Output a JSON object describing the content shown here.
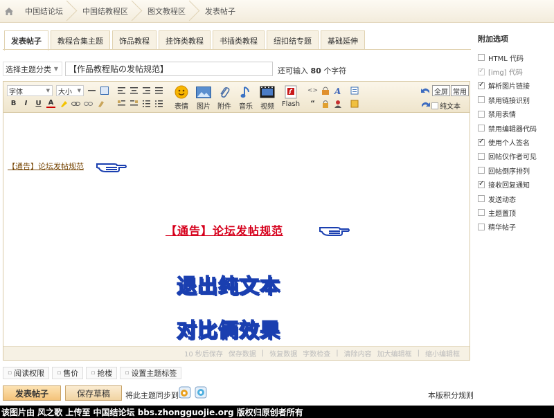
{
  "breadcrumb": {
    "items": [
      "中国结论坛",
      "中国结教程区",
      "图文教程区",
      "发表帖子"
    ]
  },
  "tabs": [
    {
      "label": "发表帖子",
      "active": true
    },
    {
      "label": "教程合集主题"
    },
    {
      "label": "饰品教程"
    },
    {
      "label": "挂饰类教程"
    },
    {
      "label": "书插类教程"
    },
    {
      "label": "纽扣结专题"
    },
    {
      "label": "基础延伸"
    }
  ],
  "form": {
    "type_select": "选择主题分类",
    "subject_value": "【作品教程贴の发帖规范】",
    "remain_prefix": "还可输入",
    "remain_count": "80",
    "remain_suffix": "个字符"
  },
  "toolbar": {
    "font": "字体",
    "size": "大小",
    "emoji": "表情",
    "image": "图片",
    "attach": "附件",
    "music": "音乐",
    "video": "视频",
    "flash": "Flash",
    "fullscreen": "全屏",
    "common": "常用",
    "plain": "纯文本",
    "btn_b": "B",
    "btn_i": "I",
    "btn_u": "U",
    "btn_a": "A",
    "quote_mark": "“",
    "code_mark": "<>"
  },
  "content": {
    "notice_small": "【通告】论坛发帖规范",
    "notice_red": "【通告】论坛发帖规范",
    "line1": "退出纯文本",
    "line2": "对比俩效果"
  },
  "status": {
    "items": [
      "10 秒后保存",
      "保存数据",
      "|",
      "恢复数据",
      "字数检查",
      "|",
      "清除内容",
      "加大编辑框",
      "|",
      "缩小编辑框"
    ]
  },
  "options": [
    "阅读权限",
    "售价",
    "抢楼",
    "设置主题标签"
  ],
  "actions": {
    "submit": "发表帖子",
    "draft": "保存草稿",
    "sync": "将此主题同步到:",
    "rules": "本版积分规则"
  },
  "sidebar": {
    "title": "附加选项",
    "items": [
      {
        "label": "HTML 代码",
        "checked": false
      },
      {
        "label": "[img] 代码",
        "checked": true,
        "disabled": true
      },
      {
        "label": "解析图片链接",
        "checked": true
      },
      {
        "label": "禁用链接识别",
        "checked": false
      },
      {
        "label": "禁用表情",
        "checked": false
      },
      {
        "label": "禁用编辑器代码",
        "checked": false
      },
      {
        "label": "使用个人签名",
        "checked": true
      },
      {
        "label": "回帖仅作者可见",
        "checked": false
      },
      {
        "label": "回帖倒序排列",
        "checked": false
      },
      {
        "label": "接收回复通知",
        "checked": true
      },
      {
        "label": "发送动态",
        "checked": false
      },
      {
        "label": "主题置顶",
        "checked": false
      },
      {
        "label": "精华帖子",
        "checked": false
      }
    ]
  },
  "footer": "该图片由 风之歌 上传至 中国结论坛 bbs.zhongguojie.org 版权归原创者所有",
  "colors": {
    "accent": "#f3ecdc",
    "notice_red": "#d6001c",
    "big_text_stroke": "#1a3fb0"
  }
}
